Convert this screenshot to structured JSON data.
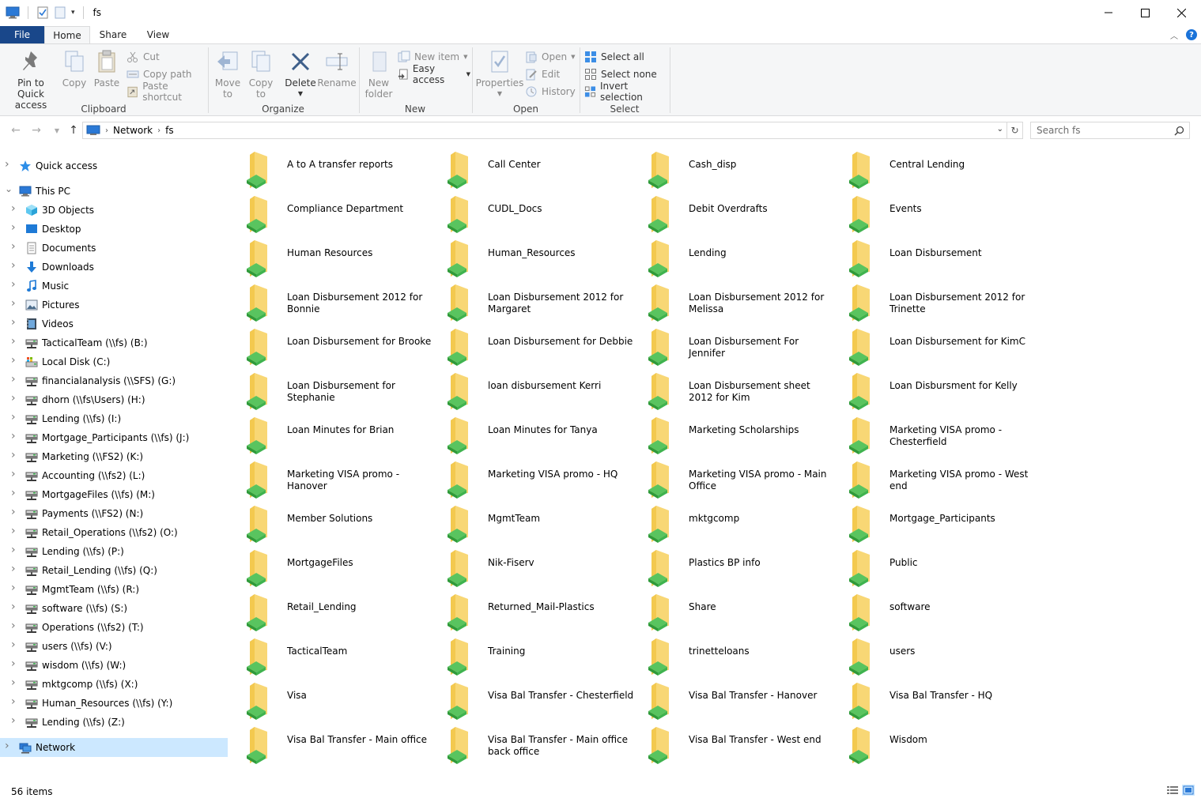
{
  "window": {
    "title": "fs"
  },
  "ribbon_tabs": [
    "File",
    "Home",
    "Share",
    "View"
  ],
  "ribbon": {
    "clipboard": {
      "label": "Clipboard",
      "pin": "Pin to Quick access",
      "pin_l1": "Pin to Quick",
      "pin_l2": "access",
      "copy": "Copy",
      "paste": "Paste",
      "cut": "Cut",
      "copy_path": "Copy path",
      "paste_shortcut": "Paste shortcut"
    },
    "organize": {
      "label": "Organize",
      "move_l1": "Move",
      "move_l2": "to",
      "copy_l1": "Copy",
      "copy_l2": "to",
      "delete": "Delete",
      "rename": "Rename"
    },
    "new": {
      "label": "New",
      "new_folder_l1": "New",
      "new_folder_l2": "folder",
      "new_item": "New item",
      "easy_access": "Easy access"
    },
    "open": {
      "label": "Open",
      "properties": "Properties",
      "open": "Open",
      "edit": "Edit",
      "history": "History"
    },
    "select": {
      "label": "Select",
      "select_all": "Select all",
      "select_none": "Select none",
      "invert": "Invert selection"
    }
  },
  "address": {
    "crumbs": [
      "Network",
      "fs"
    ]
  },
  "search": {
    "placeholder": "Search fs"
  },
  "nav": [
    {
      "label": "Quick access",
      "icon": "star-icon",
      "level": 0
    },
    {
      "label": "This PC",
      "icon": "computer-icon",
      "level": 0,
      "expanded": true
    },
    {
      "label": "3D Objects",
      "icon": "cube-icon",
      "level": 1
    },
    {
      "label": "Desktop",
      "icon": "desktop-icon",
      "level": 1
    },
    {
      "label": "Documents",
      "icon": "documents-icon",
      "level": 1
    },
    {
      "label": "Downloads",
      "icon": "download-icon",
      "level": 1
    },
    {
      "label": "Music",
      "icon": "music-icon",
      "level": 1
    },
    {
      "label": "Pictures",
      "icon": "pictures-icon",
      "level": 1
    },
    {
      "label": "Videos",
      "icon": "videos-icon",
      "level": 1
    },
    {
      "label": "TacticalTeam (\\\\fs) (B:)",
      "icon": "network-drive-icon",
      "level": 1
    },
    {
      "label": "Local Disk (C:)",
      "icon": "local-disk-icon",
      "level": 1
    },
    {
      "label": "financialanalysis (\\\\SFS) (G:)",
      "icon": "network-drive-icon",
      "level": 1
    },
    {
      "label": "dhorn (\\\\fs\\Users) (H:)",
      "icon": "network-drive-icon",
      "level": 1
    },
    {
      "label": "Lending (\\\\fs) (I:)",
      "icon": "network-drive-icon",
      "level": 1
    },
    {
      "label": "Mortgage_Participants (\\\\fs) (J:)",
      "icon": "network-drive-icon",
      "level": 1
    },
    {
      "label": "Marketing (\\\\FS2) (K:)",
      "icon": "network-drive-icon",
      "level": 1
    },
    {
      "label": "Accounting (\\\\fs2) (L:)",
      "icon": "network-drive-icon",
      "level": 1
    },
    {
      "label": "MortgageFiles (\\\\fs) (M:)",
      "icon": "network-drive-icon",
      "level": 1
    },
    {
      "label": "Payments (\\\\FS2) (N:)",
      "icon": "network-drive-icon",
      "level": 1
    },
    {
      "label": "Retail_Operations (\\\\fs2) (O:)",
      "icon": "network-drive-icon",
      "level": 1
    },
    {
      "label": "Lending (\\\\fs) (P:)",
      "icon": "network-drive-icon",
      "level": 1
    },
    {
      "label": "Retail_Lending (\\\\fs) (Q:)",
      "icon": "network-drive-icon",
      "level": 1
    },
    {
      "label": "MgmtTeam (\\\\fs) (R:)",
      "icon": "network-drive-icon",
      "level": 1
    },
    {
      "label": "software (\\\\fs) (S:)",
      "icon": "network-drive-icon",
      "level": 1
    },
    {
      "label": "Operations (\\\\fs2) (T:)",
      "icon": "network-drive-icon",
      "level": 1
    },
    {
      "label": "users (\\\\fs) (V:)",
      "icon": "network-drive-icon",
      "level": 1
    },
    {
      "label": "wisdom (\\\\fs) (W:)",
      "icon": "network-drive-icon",
      "level": 1
    },
    {
      "label": "mktgcomp (\\\\fs) (X:)",
      "icon": "network-drive-icon",
      "level": 1
    },
    {
      "label": "Human_Resources (\\\\fs) (Y:)",
      "icon": "network-drive-icon",
      "level": 1
    },
    {
      "label": "Lending (\\\\fs) (Z:)",
      "icon": "network-drive-icon",
      "level": 1
    },
    {
      "label": "Network",
      "icon": "network-icon",
      "level": 0,
      "selected": true
    }
  ],
  "folders": [
    "A to A transfer reports",
    "Call Center",
    "Cash_disp",
    "Central Lending",
    "Compliance Department",
    "CUDL_Docs",
    "Debit Overdrafts",
    "Events",
    "Human Resources",
    "Human_Resources",
    "Lending",
    "Loan Disbursement",
    "Loan Disbursement 2012 for Bonnie",
    "Loan Disbursement 2012 for Margaret",
    "Loan Disbursement 2012 for Melissa",
    "Loan Disbursement 2012 for Trinette",
    "Loan Disbursement for Brooke",
    "Loan Disbursement for Debbie",
    "Loan Disbursement For Jennifer",
    "Loan Disbursement for KimC",
    "Loan Disbursement for Stephanie",
    "loan disbursement Kerri",
    "Loan Disbursement sheet 2012 for Kim",
    "Loan Disbursment for Kelly",
    "Loan Minutes for Brian",
    "Loan Minutes for Tanya",
    "Marketing Scholarships",
    "Marketing VISA promo - Chesterfield",
    "Marketing VISA promo - Hanover",
    "Marketing VISA promo - HQ",
    "Marketing VISA promo - Main Office",
    "Marketing VISA promo - West end",
    "Member Solutions",
    "MgmtTeam",
    "mktgcomp",
    "Mortgage_Participants",
    "MortgageFiles",
    "Nik-Fiserv",
    "Plastics BP info",
    "Public",
    "Retail_Lending",
    "Returned_Mail-Plastics",
    "Share",
    "software",
    "TacticalTeam",
    "Training",
    "trinetteloans",
    "users",
    "Visa",
    "Visa Bal Transfer - Chesterfield",
    "Visa Bal Transfer - Hanover",
    "Visa Bal Transfer - HQ",
    "Visa Bal Transfer - Main office",
    "Visa Bal Transfer - Main office back office",
    "Visa Bal Transfer - West end",
    "Wisdom"
  ],
  "status": {
    "count": "56 items"
  },
  "colors": {
    "accent": "#19478a",
    "selection": "#cce8ff",
    "folder": "#f8d775",
    "share": "#3fb34f"
  }
}
